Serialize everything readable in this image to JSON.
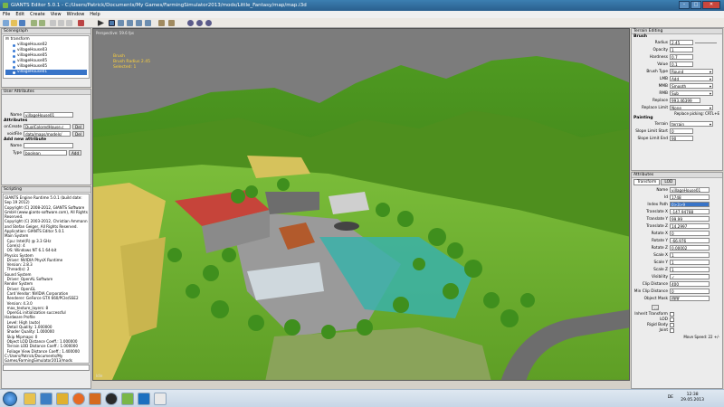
{
  "window": {
    "title": "GIANTS Editor 5.0.1 - C:/Users/Patrick/Documents/My Games/FarmingSimulator2013/mods/Little_Fantasy/map/map.i3d",
    "buttons": [
      "–",
      "□",
      "✕"
    ]
  },
  "menu": [
    "File",
    "Edit",
    "Create",
    "View",
    "Window",
    "Help"
  ],
  "scenegraph": {
    "title": "Scenegraph",
    "root": "transform",
    "items": [
      "villageHouse02",
      "villageHouse03",
      "villageHouse05",
      "villageHouse05",
      "villageHouse05",
      "villageHouse01"
    ]
  },
  "user_attributes": {
    "title": "User Attributes",
    "name_label": "Name",
    "name_value": "villageHouse01",
    "attributes_heading": "Attributes",
    "oncreate_label": "onCreate",
    "oncreate_value": "DualColoredHouse.c",
    "voidfile_label": "voidFile",
    "voidfile_value": "data/maps/models/",
    "del_label": "Del",
    "new_heading": "Add new attribute",
    "new_name_label": "Name",
    "type_label": "Type",
    "type_value": "boolean",
    "add_label": "Add"
  },
  "scripting": {
    "title": "Scripting",
    "log": "GIANTS Engine Runtime 5.0.1 (build date: Sep 19 2012)\nCopyright (C) 2008-2012, GIANTS Software GmbH (www.giants-software.com), All Rights Reserved.\nCopyright (C) 2003-2012, Christian Ammann and Stefan Geiger, All Rights Reserved.\nApplication: GIANTS Editor 5.0.1\nMain System\n  Cpu: Intel(R) @ 3.3 GHz\n  Core(s): 4\n  OS: Windows NT 6.1 64-bit\nPhysics System\n  Driver: NVIDIA PhysX Runtime\n  Version: 2.8.3\n  Thread(s): 2\nSound System\n  Driver: OpenAL Software\nRender System\n  Driver: OpenGL\n  Card Vendor: NVIDIA Corporation\n  Renderer: GeForce GTX 660/PCIe/SSE2\n  Version: 4.3.0\n  max_texture_layers: 8\n  OpenGL initialization successful\nHardware Profile\n  Level: High (auto)\n  Detail Quality: 1.000000\n  Shader Quality: 1.000000\n  Skip Mipmaps: 0\n  Object LOD Distance Coeff.: 1.000000\n  Terrain LOD Distance Coeff.: 1.000000\n  Foliage View Distance Coeff.: 1.400000\nC:/Users/Patrick/Documents/My Games/FarmingSimulator2013/mods"
  },
  "viewport": {
    "camera": "Perspective: 59.6 fps",
    "sel_label": "Brush",
    "sel_lines": [
      "Brush Radius 2.45",
      "Selected: 1"
    ],
    "footer": "Idle"
  },
  "terrain_editing": {
    "title": "Terrain Editing",
    "brush_heading": "Brush",
    "radius_label": "Radius",
    "radius_value": "2.45",
    "opacity_label": "Opacity",
    "opacity_value": "1",
    "hardness_label": "Hardness",
    "hardness_value": "0.7",
    "value_label": "Value",
    "value_value": "0.1",
    "brushtype_label": "Brush Type",
    "brushtype_value": "Round",
    "lmb_label": "LMB",
    "lmb_value": "Add",
    "mmb_label": "MMB",
    "mmb_value": "Smooth",
    "rmb_label": "RMB",
    "rmb_value": "Sub",
    "replace_label": "Replace",
    "replace_value": "993.46399",
    "replacelimit_label": "Replace Limit",
    "replacelimit_value": "None",
    "picking_hint": "Replace picking: CRTL+E",
    "painting_heading": "Painting",
    "terrain_label": "Terrain",
    "terrain_value": "terrain",
    "slopestart_label": "Slope Limit Start",
    "slopestart_value": "0",
    "slopeend_label": "Slope Limit End",
    "slopeend_value": "90"
  },
  "attributes": {
    "title": "Attributes",
    "tabs": [
      "Transform",
      "LOD"
    ],
    "fields": [
      {
        "label": "Name",
        "value": "villageHouse01"
      },
      {
        "label": "Id",
        "value": "1748"
      },
      {
        "label": "Index Path",
        "value": "0>3>9"
      },
      {
        "label": "Translate X",
        "value": "-147.94788"
      },
      {
        "label": "Translate Y",
        "value": "99.99"
      },
      {
        "label": "Translate Z",
        "value": "14.2997"
      },
      {
        "label": "Rotate X",
        "value": "0"
      },
      {
        "label": "Rotate Y",
        "value": "-66.976"
      },
      {
        "label": "Rotate Z",
        "value": "0.00002"
      },
      {
        "label": "Scale X",
        "value": "1"
      },
      {
        "label": "Scale Y",
        "value": "1"
      },
      {
        "label": "Scale Z",
        "value": "1"
      },
      {
        "label": "Visibility",
        "value": "✓"
      },
      {
        "label": "Clip Distance",
        "value": "400"
      },
      {
        "label": "Min Clip Distance",
        "value": "0"
      },
      {
        "label": "Object Mask",
        "value": "ffffff"
      }
    ],
    "checks": [
      "Inherit Transform",
      "LOD",
      "Rigid Body",
      "Joint"
    ],
    "speed": "Move Speed: 22 +/-"
  },
  "taskbar": {
    "lang": "DE",
    "time": "12:38",
    "date": "29.05.2013"
  },
  "colors": {
    "title": "#2a5f8e",
    "sky": "#7c7c7c",
    "grass": "#6fae2c",
    "roof": "#c6443a"
  }
}
